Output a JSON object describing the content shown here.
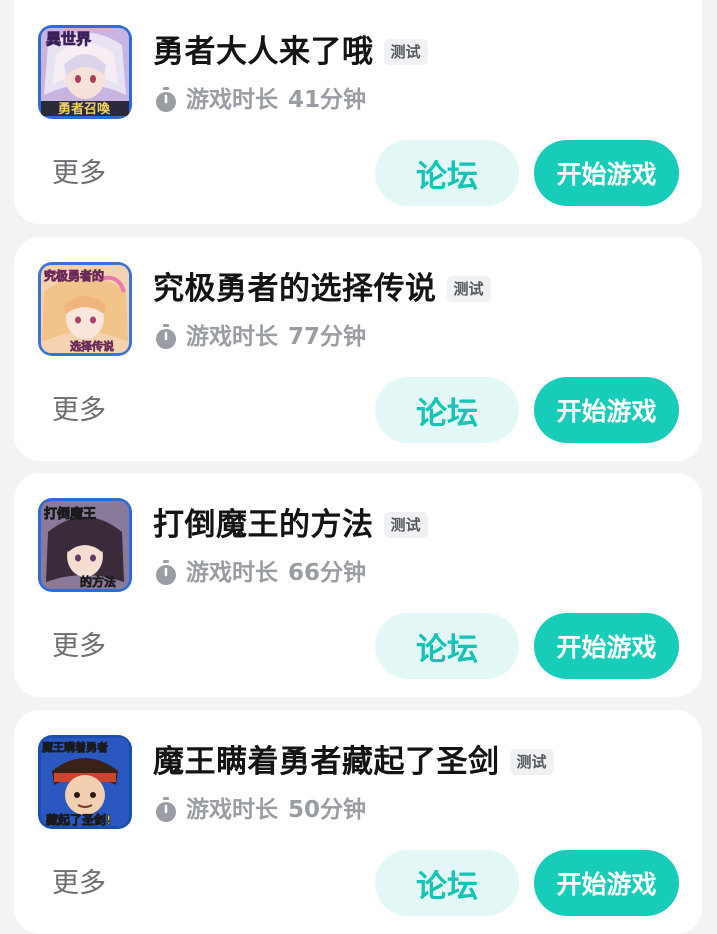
{
  "games": [
    {
      "title": "勇者大人来了哦",
      "badge": "测试",
      "playtime_label": "游戏时长",
      "playtime_value": "41分钟",
      "more_label": "更多",
      "forum_label": "论坛",
      "play_label": "开始游戏",
      "thumb_text_top": "異世界",
      "thumb_text_bottom": "勇者召喚"
    },
    {
      "title": "究极勇者的选择传说",
      "badge": "测试",
      "playtime_label": "游戏时长",
      "playtime_value": "77分钟",
      "more_label": "更多",
      "forum_label": "论坛",
      "play_label": "开始游戏",
      "thumb_text_top": "究极勇者的",
      "thumb_text_bottom": "选择传说"
    },
    {
      "title": "打倒魔王的方法",
      "badge": "测试",
      "playtime_label": "游戏时长",
      "playtime_value": "66分钟",
      "more_label": "更多",
      "forum_label": "论坛",
      "play_label": "开始游戏",
      "thumb_text_top": "打倒魔王",
      "thumb_text_bottom": "的方法"
    },
    {
      "title": "魔王瞒着勇者藏起了圣剑",
      "badge": "测试",
      "playtime_label": "游戏时长",
      "playtime_value": "50分钟",
      "more_label": "更多",
      "forum_label": "论坛",
      "play_label": "开始游戏",
      "thumb_text_top": "魔王瞒着勇者",
      "thumb_text_bottom": "藏起了圣剑!"
    }
  ],
  "icons": {
    "timer": "stopwatch-icon"
  },
  "colors": {
    "accent": "#17cdb9",
    "forum_bg": "#e3f8f6",
    "forum_text": "#15c4b4",
    "page_bg": "#f2f3f5"
  }
}
